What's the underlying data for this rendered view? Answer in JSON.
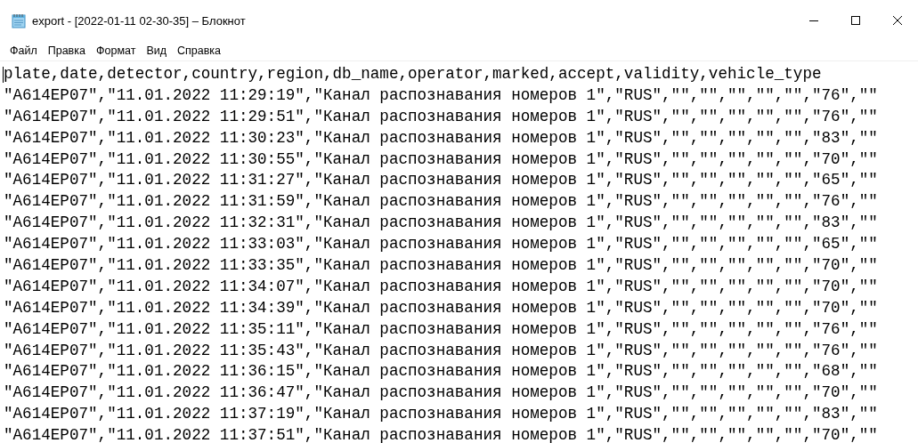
{
  "window": {
    "title": "export - [2022-01-11 02-30-35] – Блокнот"
  },
  "menu": [
    "Файл",
    "Правка",
    "Формат",
    "Вид",
    "Справка"
  ],
  "editor": {
    "lines": [
      "plate,date,detector,country,region,db_name,operator,marked,accept,validity,vehicle_type",
      "\"A614EP07\",\"11.01.2022 11:29:19\",\"Канал распознавания номеров 1\",\"RUS\",\"\",\"\",\"\",\"\",\"\",\"76\",\"\"",
      "\"A614EP07\",\"11.01.2022 11:29:51\",\"Канал распознавания номеров 1\",\"RUS\",\"\",\"\",\"\",\"\",\"\",\"76\",\"\"",
      "\"A614EP07\",\"11.01.2022 11:30:23\",\"Канал распознавания номеров 1\",\"RUS\",\"\",\"\",\"\",\"\",\"\",\"83\",\"\"",
      "\"A614EP07\",\"11.01.2022 11:30:55\",\"Канал распознавания номеров 1\",\"RUS\",\"\",\"\",\"\",\"\",\"\",\"70\",\"\"",
      "\"A614EP07\",\"11.01.2022 11:31:27\",\"Канал распознавания номеров 1\",\"RUS\",\"\",\"\",\"\",\"\",\"\",\"65\",\"\"",
      "\"A614EP07\",\"11.01.2022 11:31:59\",\"Канал распознавания номеров 1\",\"RUS\",\"\",\"\",\"\",\"\",\"\",\"76\",\"\"",
      "\"A614EP07\",\"11.01.2022 11:32:31\",\"Канал распознавания номеров 1\",\"RUS\",\"\",\"\",\"\",\"\",\"\",\"83\",\"\"",
      "\"A614EP07\",\"11.01.2022 11:33:03\",\"Канал распознавания номеров 1\",\"RUS\",\"\",\"\",\"\",\"\",\"\",\"65\",\"\"",
      "\"A614EP07\",\"11.01.2022 11:33:35\",\"Канал распознавания номеров 1\",\"RUS\",\"\",\"\",\"\",\"\",\"\",\"70\",\"\"",
      "\"A614EP07\",\"11.01.2022 11:34:07\",\"Канал распознавания номеров 1\",\"RUS\",\"\",\"\",\"\",\"\",\"\",\"70\",\"\"",
      "\"A614EP07\",\"11.01.2022 11:34:39\",\"Канал распознавания номеров 1\",\"RUS\",\"\",\"\",\"\",\"\",\"\",\"70\",\"\"",
      "\"A614EP07\",\"11.01.2022 11:35:11\",\"Канал распознавания номеров 1\",\"RUS\",\"\",\"\",\"\",\"\",\"\",\"76\",\"\"",
      "\"A614EP07\",\"11.01.2022 11:35:43\",\"Канал распознавания номеров 1\",\"RUS\",\"\",\"\",\"\",\"\",\"\",\"76\",\"\"",
      "\"A614EP07\",\"11.01.2022 11:36:15\",\"Канал распознавания номеров 1\",\"RUS\",\"\",\"\",\"\",\"\",\"\",\"68\",\"\"",
      "\"A614EP07\",\"11.01.2022 11:36:47\",\"Канал распознавания номеров 1\",\"RUS\",\"\",\"\",\"\",\"\",\"\",\"70\",\"\"",
      "\"A614EP07\",\"11.01.2022 11:37:19\",\"Канал распознавания номеров 1\",\"RUS\",\"\",\"\",\"\",\"\",\"\",\"83\",\"\"",
      "\"A614EP07\",\"11.01.2022 11:37:51\",\"Канал распознавания номеров 1\",\"RUS\",\"\",\"\",\"\",\"\",\"\",\"70\",\"\""
    ]
  }
}
